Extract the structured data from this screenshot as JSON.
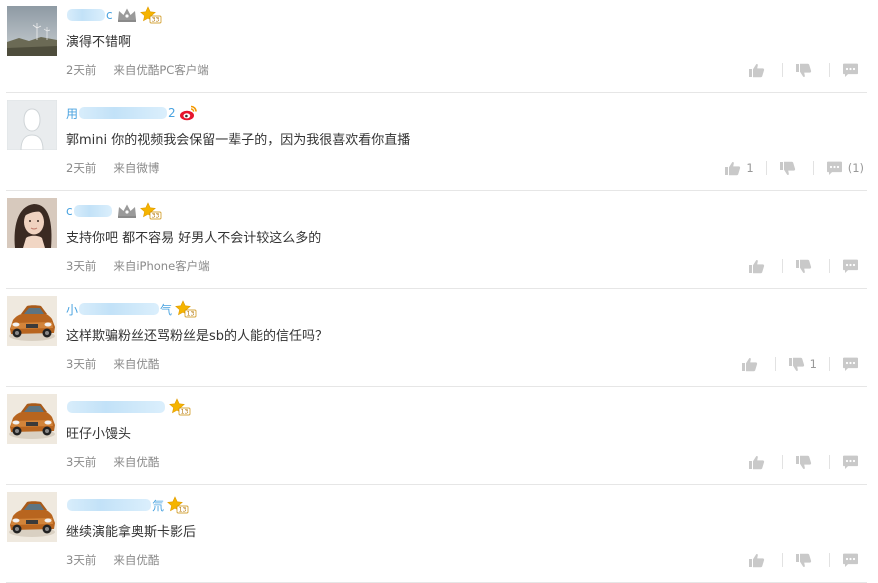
{
  "comments": [
    {
      "name_visible_start": "",
      "name_visible_end": "c",
      "name_blur_width": 38,
      "badges": [
        "crown",
        "star"
      ],
      "star_level": "33",
      "avatar": "landscape",
      "text": "演得不错啊",
      "time": "2天前",
      "source": "来自优酷PC客户端",
      "like_count": "",
      "dislike_count": "",
      "reply_count": ""
    },
    {
      "name_visible_start": "用",
      "name_visible_end": "2",
      "name_blur_width": 88,
      "badges": [
        "weibo"
      ],
      "star_level": "",
      "avatar": "default",
      "text": "郭mini 你的视频我会保留一辈子的，因为我很喜欢看你直播",
      "time": "2天前",
      "source": "来自微博",
      "like_count": "1",
      "dislike_count": "",
      "reply_count": "(1)"
    },
    {
      "name_visible_start": "c",
      "name_visible_end": "",
      "name_blur_width": 38,
      "badges": [
        "crown",
        "star"
      ],
      "star_level": "33",
      "avatar": "woman",
      "text": "支持你吧 都不容易 好男人不会计较这么多的",
      "time": "3天前",
      "source": "来自iPhone客户端",
      "like_count": "",
      "dislike_count": "",
      "reply_count": ""
    },
    {
      "name_visible_start": "小",
      "name_visible_end": "气",
      "name_blur_width": 80,
      "badges": [
        "star"
      ],
      "star_level": "13",
      "avatar": "car",
      "text": "这样欺骗粉丝还骂粉丝是sb的人能的信任吗？",
      "time": "3天前",
      "source": "来自优酷",
      "like_count": "",
      "dislike_count": "1",
      "reply_count": ""
    },
    {
      "name_visible_start": "",
      "name_visible_end": "",
      "name_blur_width": 98,
      "badges": [
        "star"
      ],
      "star_level": "13",
      "avatar": "car",
      "text": "旺仔小馒头",
      "time": "3天前",
      "source": "来自优酷",
      "like_count": "",
      "dislike_count": "",
      "reply_count": ""
    },
    {
      "name_visible_start": "",
      "name_visible_end": "氘",
      "name_blur_width": 84,
      "badges": [
        "star"
      ],
      "star_level": "13",
      "avatar": "car",
      "text": "继续演能拿奥斯卡影后",
      "time": "3天前",
      "source": "来自优酷",
      "like_count": "",
      "dislike_count": "",
      "reply_count": ""
    }
  ],
  "colors": {
    "username": "#4aa3e0",
    "meta": "#8a8a8a",
    "divider": "#e6e6e6",
    "icon": "#c8c8c8",
    "star": "#f5b400"
  },
  "icons": {
    "like": "thumbs-up-icon",
    "dislike": "thumbs-down-icon",
    "reply": "chat-bubble-icon",
    "crown": "crown-icon",
    "star": "star-level-icon",
    "weibo": "weibo-logo-icon"
  }
}
